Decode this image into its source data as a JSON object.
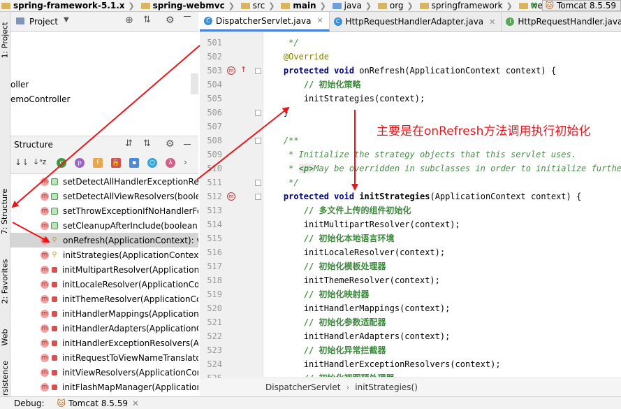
{
  "breadcrumbs": [
    "spring-framework-5.1.x",
    "spring-webmvc",
    "src",
    "main",
    "java",
    "org",
    "springframework",
    "web"
  ],
  "run_config": "Tomcat 8.5.59",
  "left_strip": {
    "project_tab": "1: Project",
    "structure_tab": "7: Structure",
    "favorites_tab": "2: Favorites",
    "web_tab": "Web",
    "persistence_tab": "Persistence"
  },
  "project_panel": {
    "title": "Project",
    "rows": [
      "oller",
      "emoController"
    ]
  },
  "structure_panel": {
    "title": "Structure",
    "items": [
      {
        "label": "setDetectAllHandlerExceptionResc",
        "vis": "pub"
      },
      {
        "label": "setDetectAllViewResolvers(boolea",
        "vis": "pub"
      },
      {
        "label": "setThrowExceptionIfNoHandlerFo",
        "vis": "pub"
      },
      {
        "label": "setCleanupAfterInclude(boolean):",
        "vis": "pub"
      },
      {
        "label": "onRefresh(ApplicationContext): vo",
        "vis": "prot",
        "selected": true
      },
      {
        "label": "initStrategies(ApplicationContext):",
        "vis": "prot"
      },
      {
        "label": "initMultipartResolver(Application(",
        "vis": "priv"
      },
      {
        "label": "initLocaleResolver(ApplicationCor",
        "vis": "priv"
      },
      {
        "label": "initThemeResolver(ApplicationCon",
        "vis": "priv"
      },
      {
        "label": "initHandlerMappings(Applicationo",
        "vis": "priv"
      },
      {
        "label": "initHandlerAdapters(ApplicationC",
        "vis": "priv"
      },
      {
        "label": "initHandlerExceptionResolvers(Ap",
        "vis": "priv"
      },
      {
        "label": "initRequestToViewNameTranslato",
        "vis": "priv"
      },
      {
        "label": "initViewResolvers(ApplicationCont",
        "vis": "priv"
      },
      {
        "label": "initFlashMapManager(Application",
        "vis": "priv"
      }
    ]
  },
  "tabs": [
    {
      "label": "DispatcherServlet.java",
      "icon": "C",
      "active": true
    },
    {
      "label": "HttpRequestHandlerAdapter.java",
      "icon": "C"
    },
    {
      "label": "HttpRequestHandler.java",
      "icon": "I"
    }
  ],
  "code": {
    "lines": [
      {
        "n": "501",
        "t": "     */",
        "c": "doc"
      },
      {
        "n": "502",
        "t": "    @Override",
        "c": "ann"
      },
      {
        "n": "503",
        "t": "    protected void onRefresh(ApplicationContext context) {",
        "c": "kwline1"
      },
      {
        "n": "504",
        "t": "        // 初始化策略",
        "c": "cmz"
      },
      {
        "n": "505",
        "t": "        initStrategies(context);",
        "c": "plain"
      },
      {
        "n": "506",
        "t": "    }",
        "c": "plain"
      },
      {
        "n": "507",
        "t": "",
        "c": "plain"
      },
      {
        "n": "508",
        "t": "    /**",
        "c": "doc"
      },
      {
        "n": "509",
        "t": "     * Initialize the strategy objects that this servlet uses.",
        "c": "doc"
      },
      {
        "n": "510",
        "t": "     * <p>May be overridden in subclasses in order to initialize further strategy objects.",
        "c": "doctag"
      },
      {
        "n": "511",
        "t": "     */",
        "c": "doc"
      },
      {
        "n": "512",
        "t": "    protected void initStrategies(ApplicationContext context) {",
        "c": "kwline2"
      },
      {
        "n": "513",
        "t": "        // 多文件上传的组件初始化",
        "c": "cmz"
      },
      {
        "n": "514",
        "t": "        initMultipartResolver(context);",
        "c": "plain"
      },
      {
        "n": "515",
        "t": "        // 初始化本地语言环境",
        "c": "cmz"
      },
      {
        "n": "516",
        "t": "        initLocaleResolver(context);",
        "c": "plain"
      },
      {
        "n": "517",
        "t": "        // 初始化模板处理器",
        "c": "cmz"
      },
      {
        "n": "518",
        "t": "        initThemeResolver(context);",
        "c": "plain"
      },
      {
        "n": "519",
        "t": "        // 初始化映射器",
        "c": "cmz"
      },
      {
        "n": "520",
        "t": "        initHandlerMappings(context);",
        "c": "plain"
      },
      {
        "n": "521",
        "t": "        // 初始化参数适配器",
        "c": "cmz"
      },
      {
        "n": "522",
        "t": "        initHandlerAdapters(context);",
        "c": "plain"
      },
      {
        "n": "523",
        "t": "        // 初始化异常拦截器",
        "c": "cmz"
      },
      {
        "n": "524",
        "t": "        initHandlerExceptionResolvers(context);",
        "c": "plain"
      },
      {
        "n": "525",
        "t": "        // 初始化视图预处理器",
        "c": "cmz"
      }
    ]
  },
  "editor_breadcrumb": [
    "DispatcherServlet",
    "initStrategies()"
  ],
  "annotation_text": "主要是在onRefresh方法调用执行初始化",
  "status": {
    "debug_label": "Debug:",
    "tomcat": "Tomcat 8.5.59"
  },
  "colors": {
    "annotation": "#e8161b",
    "keyword": "#000080",
    "comment": "#3c8a3c",
    "selection": "#d5d5d5"
  }
}
